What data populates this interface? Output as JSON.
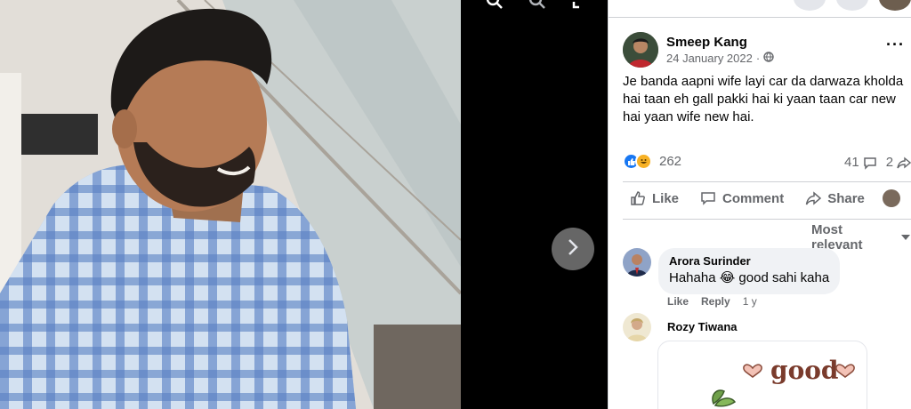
{
  "viewer": {
    "icons": [
      "zoom-in-icon",
      "zoom-out-icon",
      "fullscreen-icon"
    ],
    "next_icon": "chevron-right-icon"
  },
  "post": {
    "author": "Smeep Kang",
    "date": "24 January 2022",
    "privacy_icon": "globe-icon",
    "text": "Je banda aapni wife layi car da darwaza kholda hai taan eh gall pakki hai ki yaan taan car new hai yaan wife new hai.",
    "reaction_count": "262",
    "comment_count": "41",
    "share_count": "2",
    "actions": {
      "like": "Like",
      "comment": "Comment",
      "share": "Share"
    },
    "sort_label": "Most relevant"
  },
  "comments": [
    {
      "author": "Arora Surinder",
      "text_before": "Hahaha",
      "emoji": "😂",
      "text_after": "good sahi kaha",
      "like": "Like",
      "reply": "Reply",
      "time": "1 y"
    },
    {
      "author": "Rozy Tiwana",
      "sticker_text": "good"
    }
  ],
  "colors": {
    "accent": "#1877f2",
    "haha": "#f7b125",
    "secondary_text": "#65676b"
  }
}
